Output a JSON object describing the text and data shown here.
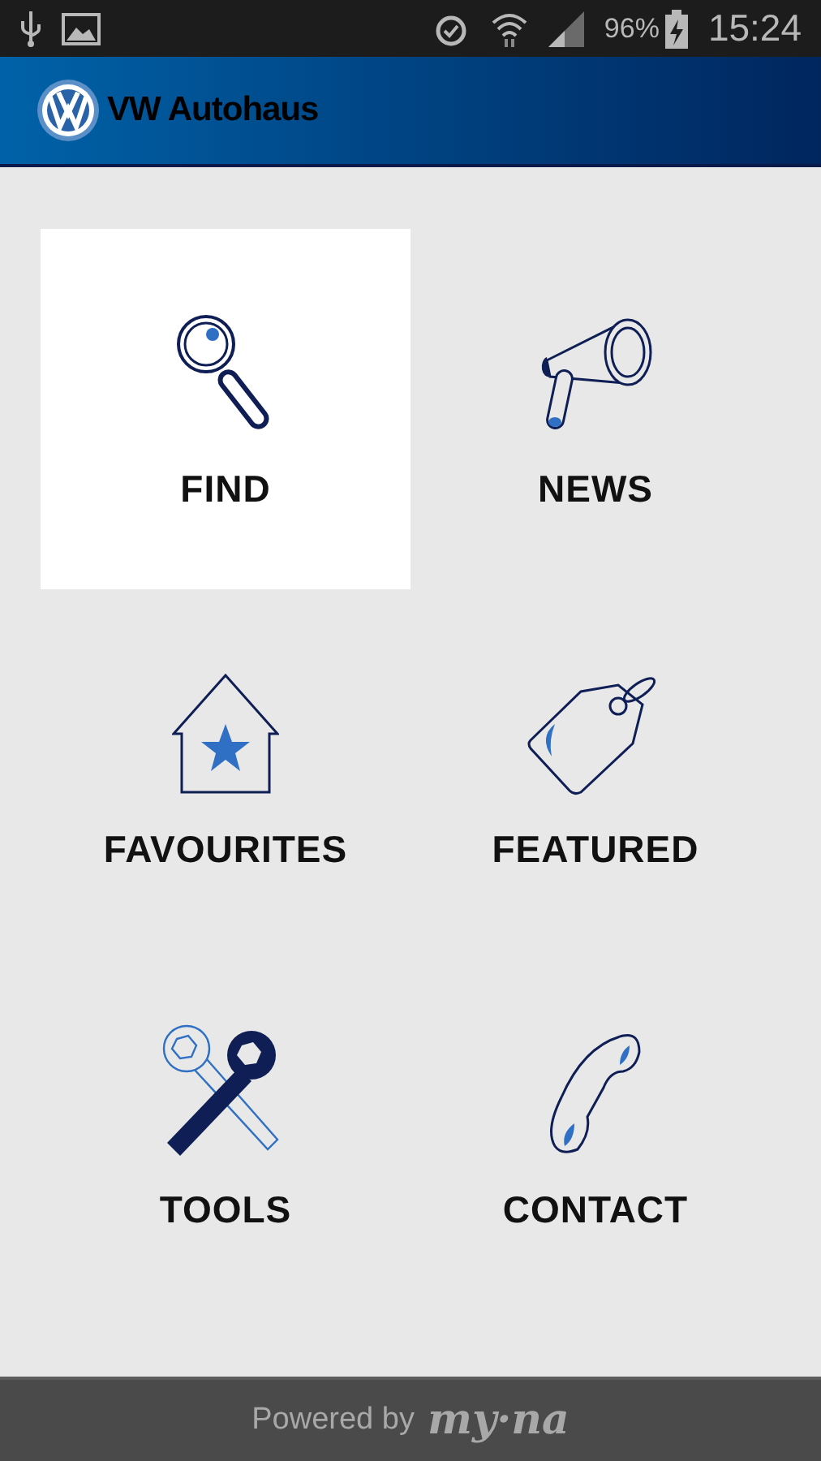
{
  "status_bar": {
    "battery": "96%",
    "time": "15:24"
  },
  "app_bar": {
    "title": "VW Autohaus"
  },
  "tiles": [
    {
      "kind": "find",
      "label": "FIND",
      "selected": true
    },
    {
      "kind": "news",
      "label": "NEWS",
      "selected": false
    },
    {
      "kind": "favourites",
      "label": "FAVOURITES",
      "selected": false
    },
    {
      "kind": "featured",
      "label": "FEATURED",
      "selected": false
    },
    {
      "kind": "tools",
      "label": "TOOLS",
      "selected": false
    },
    {
      "kind": "contact",
      "label": "CONTACT",
      "selected": false
    }
  ],
  "footer": {
    "text": "Powered by",
    "brand": "my·na"
  }
}
